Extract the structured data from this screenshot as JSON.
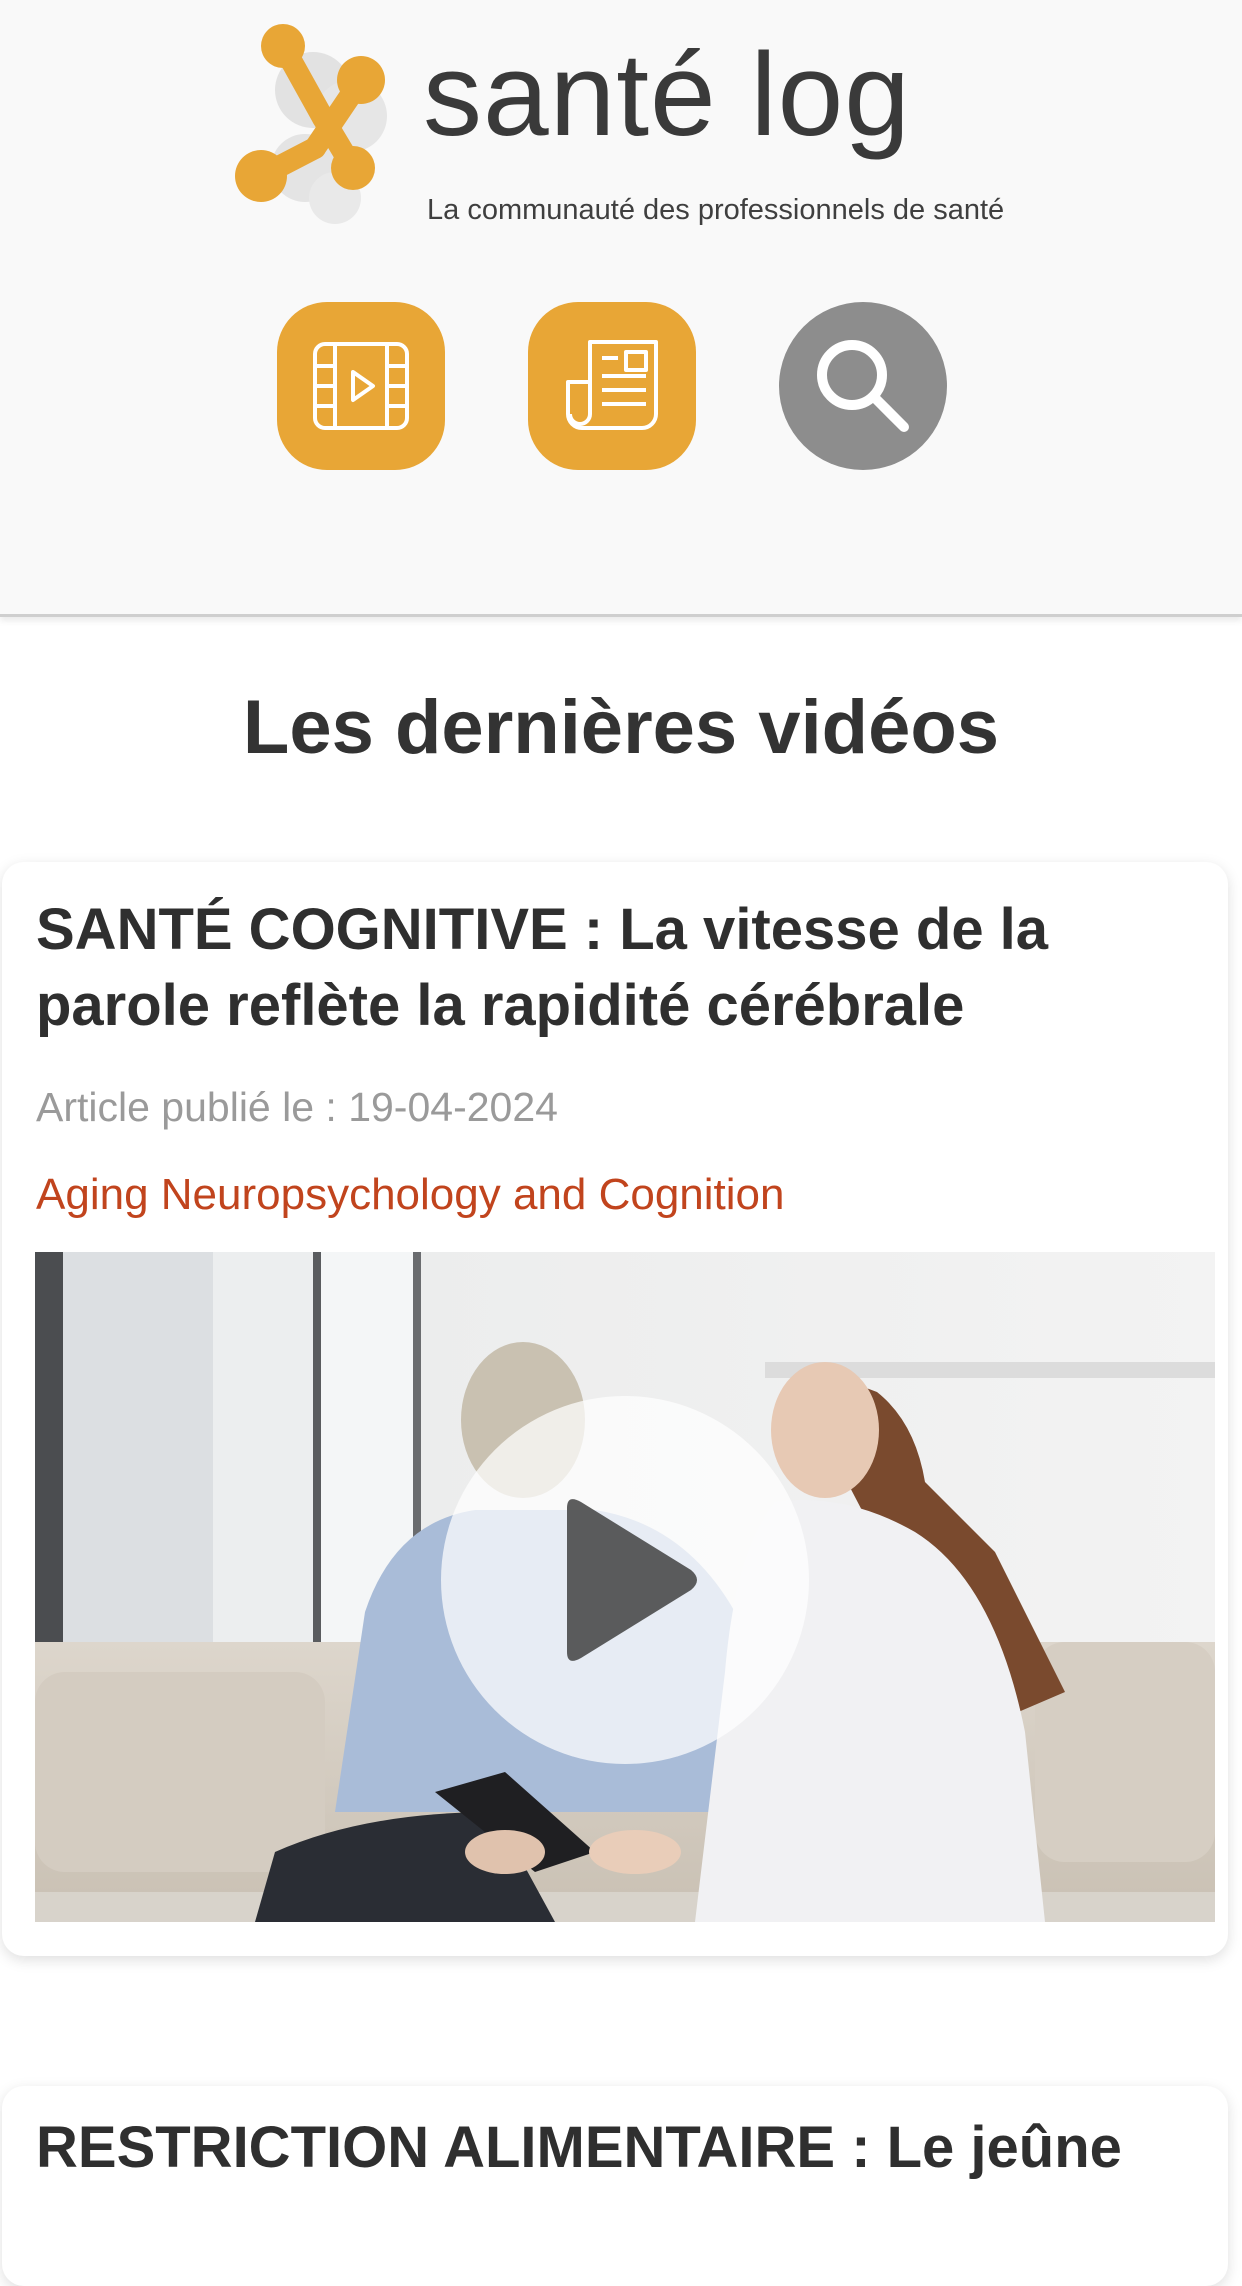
{
  "header": {
    "logo_name": "santé log",
    "logo_tagline": "La communauté des professionnels de santé",
    "brand_color": "#e8a636",
    "nav": [
      {
        "icon": "video-icon",
        "color": "#e8a636"
      },
      {
        "icon": "newspaper-icon",
        "color": "#e8a636"
      },
      {
        "icon": "search-icon",
        "color": "#8d8d8d"
      }
    ]
  },
  "main": {
    "section_title": "Les dernières vidéos",
    "articles": [
      {
        "title": "SANTÉ COGNITIVE : La vitesse de la parole reflète la rapidité cérébrale",
        "date": "Article publié le : 19-04-2024",
        "source": "Aging Neuropsychology and Cognition",
        "source_color": "#c1441d",
        "media": "play-icon"
      },
      {
        "title": "RESTRICTION ALIMENTAIRE : Le jeûne"
      }
    ]
  }
}
